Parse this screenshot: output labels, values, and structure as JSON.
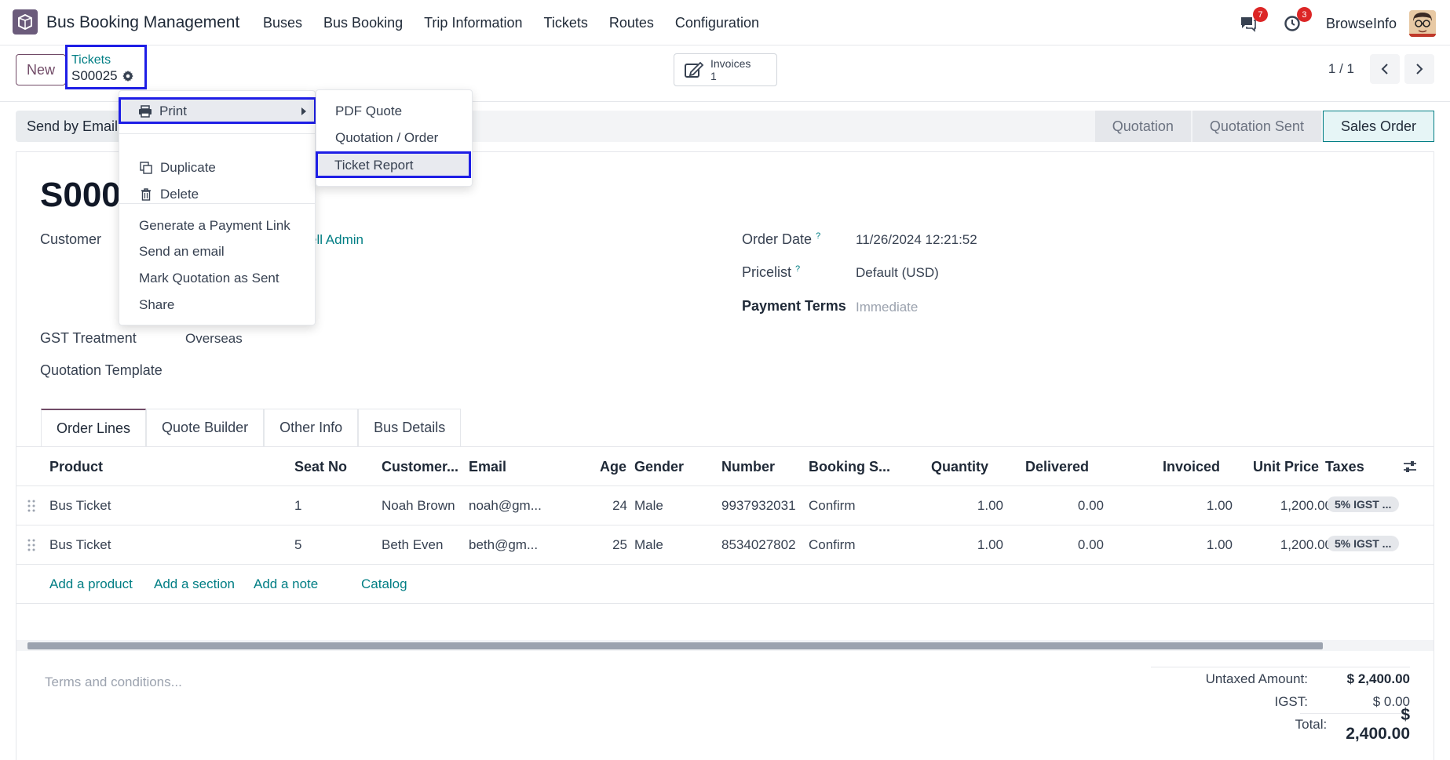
{
  "app": {
    "name": "Bus Booking Management"
  },
  "menu": [
    "Buses",
    "Bus Booking",
    "Trip Information",
    "Tickets",
    "Routes",
    "Configuration"
  ],
  "systray": {
    "messages_count": "7",
    "activities_count": "3",
    "company": "BrowseInfo"
  },
  "control": {
    "new_label": "New",
    "breadcrumb_parent": "Tickets",
    "breadcrumb_record": "S00025",
    "invoices_label": "Invoices",
    "invoices_count": "1",
    "pager": "1 / 1"
  },
  "status": {
    "send_email": "Send by Email",
    "stages": [
      "Quotation",
      "Quotation Sent",
      "Sales Order"
    ],
    "active_stage": "Sales Order"
  },
  "form": {
    "title": "S0002",
    "customer_label": "Customer",
    "customer_value": "ell Admin",
    "gst_label": "GST Treatment",
    "gst_value": "Overseas",
    "template_label": "Quotation Template",
    "order_date_label": "Order Date",
    "order_date_value": "11/26/2024 12:21:52",
    "pricelist_label": "Pricelist",
    "pricelist_value": "Default (USD)",
    "payment_terms_label": "Payment Terms",
    "payment_terms_value": "Immediate"
  },
  "tabs": [
    "Order Lines",
    "Quote Builder",
    "Other Info",
    "Bus Details"
  ],
  "table": {
    "headers": [
      "Product",
      "Seat No",
      "Customer...",
      "Email",
      "Age",
      "Gender",
      "Number",
      "Booking S...",
      "Quantity",
      "Delivered",
      "Invoiced",
      "Unit Price",
      "Taxes"
    ],
    "rows": [
      {
        "product": "Bus Ticket",
        "seat": "1",
        "customer": "Noah Brown",
        "email": "noah@gm...",
        "age": "24",
        "gender": "Male",
        "number": "9937932031",
        "booking": "Confirm",
        "qty": "1.00",
        "delivered": "0.00",
        "invoiced": "1.00",
        "price": "1,200.00",
        "tax": "5% IGST ..."
      },
      {
        "product": "Bus Ticket",
        "seat": "5",
        "customer": "Beth Even",
        "email": "beth@gm...",
        "age": "25",
        "gender": "Male",
        "number": "8534027802",
        "booking": "Confirm",
        "qty": "1.00",
        "delivered": "0.00",
        "invoiced": "1.00",
        "price": "1,200.00",
        "tax": "5% IGST ..."
      }
    ],
    "add_links": [
      "Add a product",
      "Add a section",
      "Add a note",
      "Catalog"
    ]
  },
  "footer": {
    "terms_placeholder": "Terms and conditions...",
    "untaxed_label": "Untaxed Amount:",
    "untaxed_value": "$ 2,400.00",
    "igst_label": "IGST:",
    "igst_value": "$ 0.00",
    "total_label": "Total:",
    "total_value": "$ 2,400.00"
  },
  "action_menu": {
    "print": "Print",
    "duplicate": "Duplicate",
    "delete": "Delete",
    "payment_link": "Generate a Payment Link",
    "send_email": "Send an email",
    "mark_sent": "Mark Quotation as Sent",
    "share": "Share"
  },
  "print_submenu": [
    "PDF Quote",
    "Quotation / Order",
    "Ticket Report"
  ],
  "colors": {
    "brand": "#714b67",
    "link": "#017e84",
    "highlight": "#1e1ee6",
    "badge": "#dc2626"
  }
}
